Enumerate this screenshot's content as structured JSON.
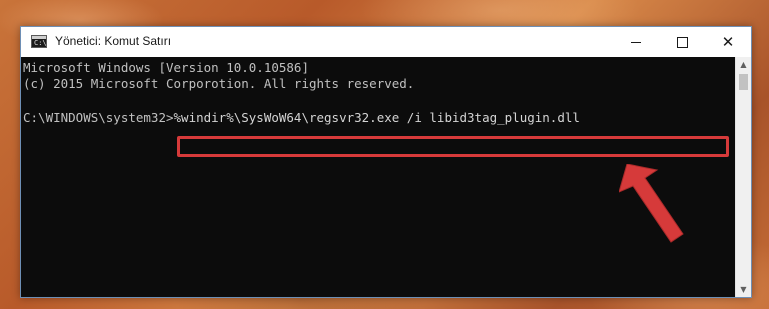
{
  "window": {
    "title": "Yönetici: Komut Satırı",
    "icon_text": "C:\\"
  },
  "controls": {
    "minimize": "minimize-icon",
    "maximize": "maximize-icon",
    "close_glyph": "✕"
  },
  "console": {
    "line1": "Microsoft Windows [Version 10.0.10586]",
    "line2": "(c) 2015 Microsoft Corporotion. All rights reserved.",
    "prompt": "C:\\WINDOWS\\system32>",
    "command": "%windir%\\SysWoW64\\regsvr32.exe /i libid3tag_plugin.dll"
  },
  "scrollbar": {
    "up_glyph": "▲",
    "down_glyph": "▼"
  },
  "colors": {
    "highlight": "#d63a3a",
    "arrow": "#d63a3a",
    "console_bg": "#0c0c0c"
  }
}
